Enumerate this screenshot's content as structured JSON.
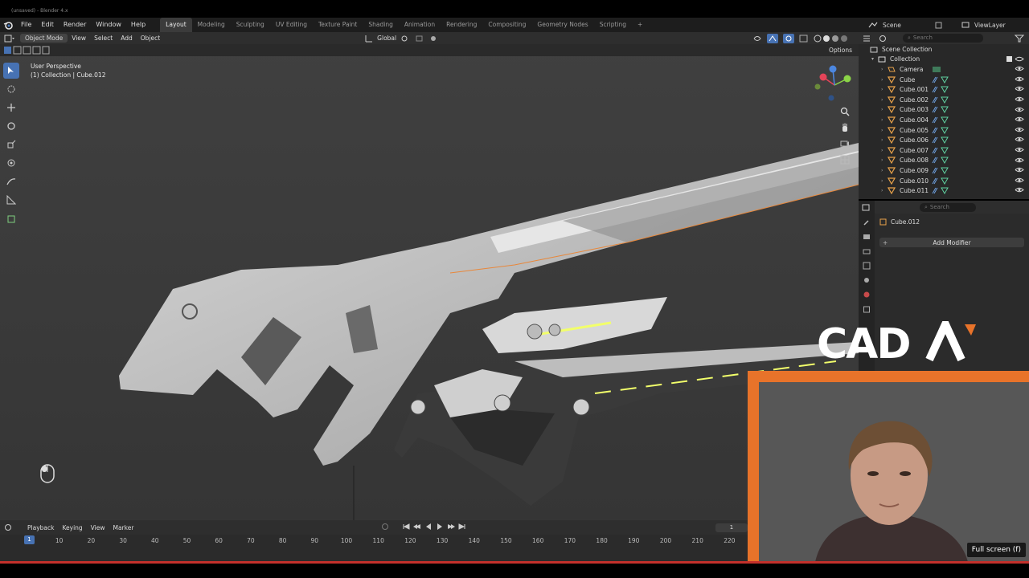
{
  "window": {
    "title": "(unsaved) - Blender 4.x"
  },
  "menubar": {
    "menus": [
      "File",
      "Edit",
      "Render",
      "Window",
      "Help"
    ],
    "workspaces": [
      "Layout",
      "Modeling",
      "Sculpting",
      "UV Editing",
      "Texture Paint",
      "Shading",
      "Animation",
      "Rendering",
      "Compositing",
      "Geometry Nodes",
      "Scripting"
    ],
    "active_workspace": "Layout",
    "add_tab": "+",
    "scene": "Scene",
    "view_layer": "ViewLayer"
  },
  "viewport": {
    "mode": "Object Mode",
    "menus": [
      "View",
      "Select",
      "Add",
      "Object"
    ],
    "transform_orientation": "Global",
    "options": "Options",
    "perspective_label": "User Perspective",
    "context_label": "(1) Collection | Cube.012"
  },
  "outliner": {
    "search_placeholder": "Search",
    "root": "Scene Collection",
    "collection": "Collection",
    "items": [
      "Camera",
      "Cube",
      "Cube.001",
      "Cube.002",
      "Cube.003",
      "Cube.004",
      "Cube.005",
      "Cube.006",
      "Cube.007",
      "Cube.008",
      "Cube.009",
      "Cube.010",
      "Cube.011"
    ]
  },
  "properties": {
    "search_placeholder": "Search",
    "object_name": "Cube.012",
    "add_modifier": "Add Modifier"
  },
  "timeline": {
    "menus": [
      "Playback",
      "Keying",
      "View",
      "Marker"
    ],
    "current_frame": "1",
    "frame_field": "1",
    "ticks": [
      "10",
      "20",
      "30",
      "40",
      "50",
      "60",
      "70",
      "80",
      "90",
      "100",
      "110",
      "120",
      "130",
      "140",
      "150",
      "160",
      "170",
      "180",
      "190",
      "200",
      "210",
      "220"
    ]
  },
  "overlay": {
    "logo_text": "CADA",
    "fullscreen_tooltip": "Full screen (f)",
    "accent_color": "#e8732a"
  }
}
